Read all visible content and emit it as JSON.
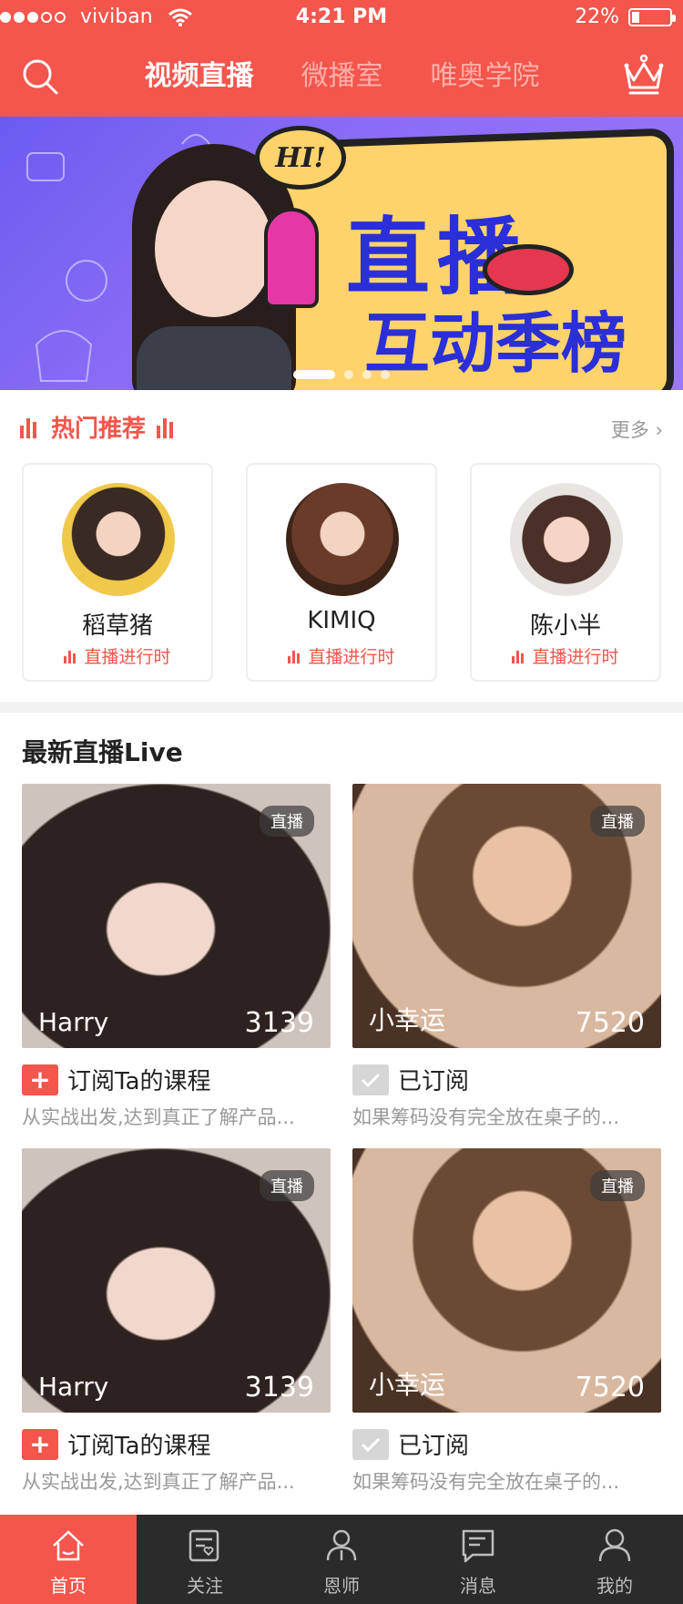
{
  "status_bar": {
    "carrier": "viviban",
    "time": "4:21 PM",
    "battery": "22%"
  },
  "header": {
    "tabs": [
      {
        "label": "视频直播",
        "active": true
      },
      {
        "label": "微播室",
        "active": false
      },
      {
        "label": "唯奥学院",
        "active": false
      }
    ]
  },
  "banner": {
    "bubble_text": "HI!",
    "headline": "直播",
    "subheadline": "互动季榜",
    "pager": {
      "current": 1,
      "total": 4
    }
  },
  "hot": {
    "title": "热门推荐",
    "more_label": "更多 ›",
    "items": [
      {
        "name": "稻草猪",
        "status": "直播进行时"
      },
      {
        "name": "KIMIQ",
        "status": "直播进行时"
      },
      {
        "name": "陈小半",
        "status": "直播进行时"
      }
    ]
  },
  "latest": {
    "title": "最新直播Live",
    "badge": "直播",
    "items": [
      {
        "name": "Harry",
        "count": "3139",
        "subscribe_label": "订阅Ta的课程",
        "subscribed": false,
        "desc": "从实战出发,达到真正了解产品..."
      },
      {
        "name": "小幸运",
        "count": "7520",
        "subscribe_label": "已订阅",
        "subscribed": true,
        "desc": "如果筹码没有完全放在桌子的..."
      },
      {
        "name": "Harry",
        "count": "3139",
        "subscribe_label": "订阅Ta的课程",
        "subscribed": false,
        "desc": "从实战出发,达到真正了解产品..."
      },
      {
        "name": "小幸运",
        "count": "7520",
        "subscribe_label": "已订阅",
        "subscribed": true,
        "desc": "如果筹码没有完全放在桌子的..."
      }
    ]
  },
  "tabbar": {
    "items": [
      {
        "label": "首页",
        "icon": "home-icon",
        "active": true
      },
      {
        "label": "关注",
        "icon": "follow-icon",
        "active": false
      },
      {
        "label": "恩师",
        "icon": "teacher-icon",
        "active": false
      },
      {
        "label": "消息",
        "icon": "message-icon",
        "active": false
      },
      {
        "label": "我的",
        "icon": "profile-icon",
        "active": false
      }
    ]
  },
  "colors": {
    "brand": "#f4554c",
    "tabbar_bg": "#2b2b2b",
    "muted_text": "#999999"
  }
}
